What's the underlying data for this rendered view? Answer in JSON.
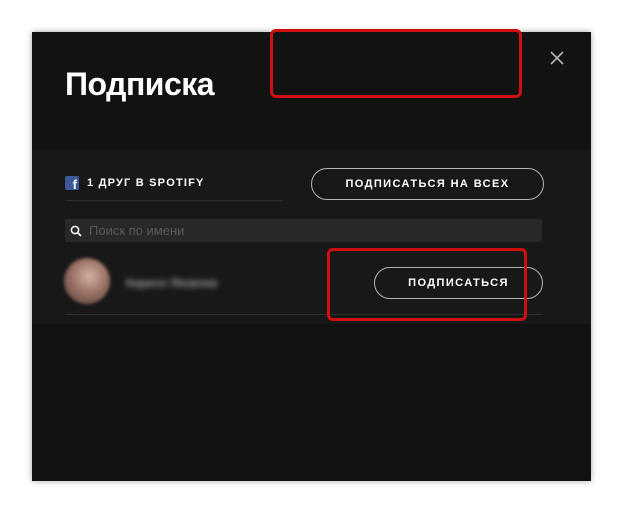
{
  "dialog": {
    "title": "Подписка",
    "close_icon": "close-icon"
  },
  "friends": {
    "source_icon": "facebook-icon",
    "source_letter": "f",
    "count_label": "1 ДРУГ В SPOTIFY",
    "follow_all_label": "ПОДПИСАТЬСЯ НА ВСЕХ"
  },
  "search": {
    "icon": "search-icon",
    "placeholder": "Поиск по имени",
    "value": ""
  },
  "friend_list": [
    {
      "name": "Кирилл Яковлев",
      "follow_label": "ПОДПИСАТЬСЯ"
    }
  ],
  "colors": {
    "background": "#121212",
    "panel": "#181818",
    "highlight": "#d01010",
    "facebook": "#3b5998"
  }
}
